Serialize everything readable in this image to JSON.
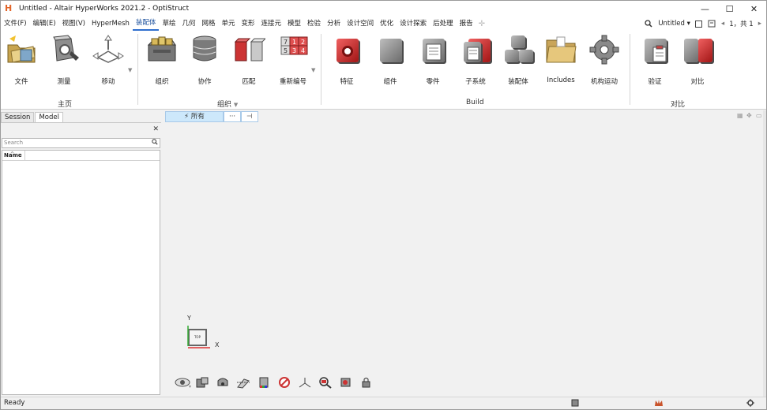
{
  "window": {
    "title": "Untitled - Altair HyperWorks 2021.2 - OptiStruct",
    "logo_glyph": "H",
    "minimize": "—",
    "maximize": "☐",
    "close": "✕"
  },
  "menu": {
    "items": [
      "文件(F)",
      "编辑(E)",
      "视图(V)",
      "HyperMesh",
      "装配体",
      "草绘",
      "几何",
      "网格",
      "单元",
      "变形",
      "连接元",
      "模型",
      "检验",
      "分析",
      "设计空间",
      "优化",
      "设计探索",
      "后处理",
      "报告"
    ],
    "active_index": 4,
    "add_tab": "✛",
    "search_icon": "search-icon",
    "session_name": "Untitled",
    "page_nav": "1，共 1"
  },
  "ribbon": {
    "groups": [
      {
        "label": "主页",
        "buttons": [
          "文件",
          "测量",
          "移动"
        ]
      },
      {
        "label": "组织",
        "buttons": [
          "组织",
          "协作",
          "匹配",
          "重新编号"
        ]
      },
      {
        "label": "Build",
        "buttons": [
          "特征",
          "组件",
          "零件",
          "子系统",
          "装配体",
          "Includes",
          "机构运动"
        ]
      },
      {
        "label": "对比",
        "buttons": [
          "验证",
          "对比"
        ]
      }
    ],
    "renumber_digits": [
      "7",
      "1",
      "2",
      "5",
      "3",
      "4"
    ]
  },
  "browser": {
    "tabs": [
      "Session",
      "Model"
    ],
    "active_tab": "Model",
    "close_glyph": "✕",
    "search_placeholder": "Search",
    "column_header": "Name"
  },
  "viewport": {
    "filter_all": "所有",
    "filter_more": "···",
    "filter_end": "⊣",
    "triad_y": "Y",
    "triad_x": "X",
    "triad_view": "TOP"
  },
  "status": {
    "text": "Ready"
  },
  "colors": {
    "accent": "#2f6fce",
    "logo": "#e2652a",
    "filter_bg": "#cde8fb"
  }
}
